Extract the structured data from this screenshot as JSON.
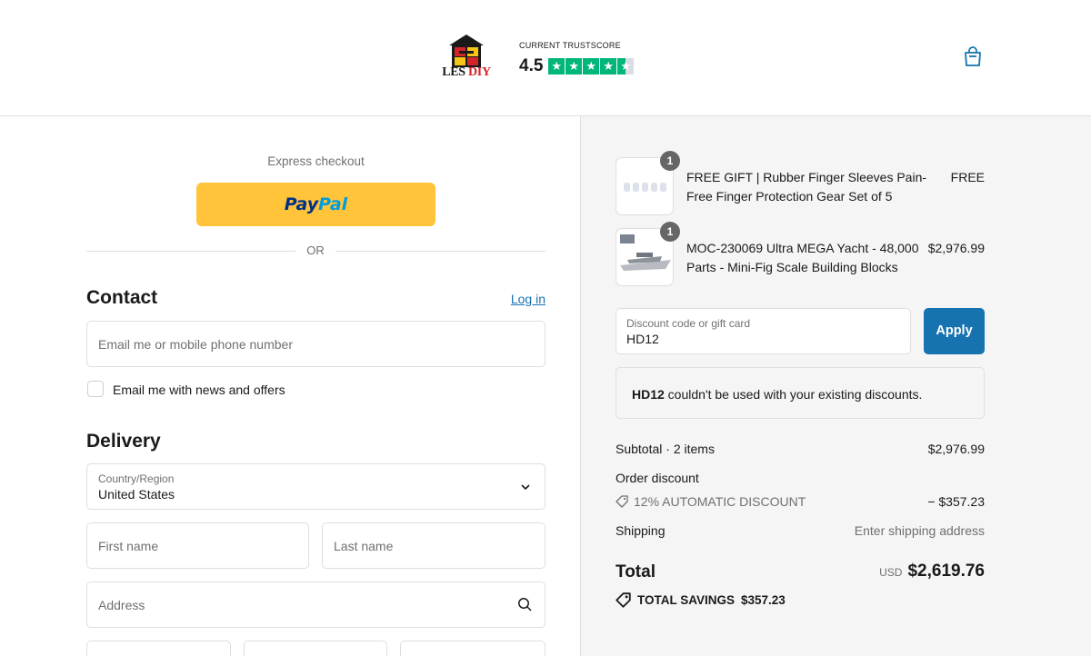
{
  "header": {
    "logo_text_1": "LES",
    "logo_text_2": "DIY",
    "trust_label": "CURRENT TRUSTSCORE",
    "trust_score": "4.5",
    "trust_star_color": "#00b67a",
    "cart_icon": "shopping-bag-icon"
  },
  "express": {
    "label": "Express checkout",
    "paypal_1": "Pay",
    "paypal_2": "Pal",
    "paypal_color": "#ffc439",
    "or_label": "OR"
  },
  "contact": {
    "title": "Contact",
    "login_label": "Log in",
    "email_placeholder": "Email me or mobile phone number",
    "newsletter_label": "Email me with news and offers",
    "newsletter_checked": false
  },
  "delivery": {
    "title": "Delivery",
    "country_label": "Country/Region",
    "country_value": "United States",
    "first_name_placeholder": "First name",
    "last_name_placeholder": "Last name",
    "address_placeholder": "Address"
  },
  "summary": {
    "items": [
      {
        "name": "FREE GIFT | Rubber Finger Sleeves Pain-Free Finger Protection Gear Set of 5",
        "price": "FREE",
        "qty": "1"
      },
      {
        "name": "MOC-230069 Ultra MEGA Yacht - 48,000 Parts - Mini-Fig Scale Building Blocks",
        "price": "$2,976.99",
        "qty": "1"
      }
    ],
    "discount_label": "Discount code or gift card",
    "discount_value": "HD12",
    "apply_label": "Apply",
    "apply_color": "#1773b0",
    "notice_code": "HD12",
    "notice_text": " couldn't be used with your existing discounts.",
    "subtotal_label": "Subtotal · 2 items",
    "subtotal_value": "$2,976.99",
    "order_discount_label": "Order discount",
    "auto_discount_label": "12% AUTOMATIC DISCOUNT",
    "auto_discount_value": "− $357.23",
    "shipping_label": "Shipping",
    "shipping_value": "Enter shipping address",
    "total_label": "Total",
    "total_currency": "USD",
    "total_value": "$2,619.76",
    "savings_label": "TOTAL SAVINGS",
    "savings_value": "$357.23"
  }
}
